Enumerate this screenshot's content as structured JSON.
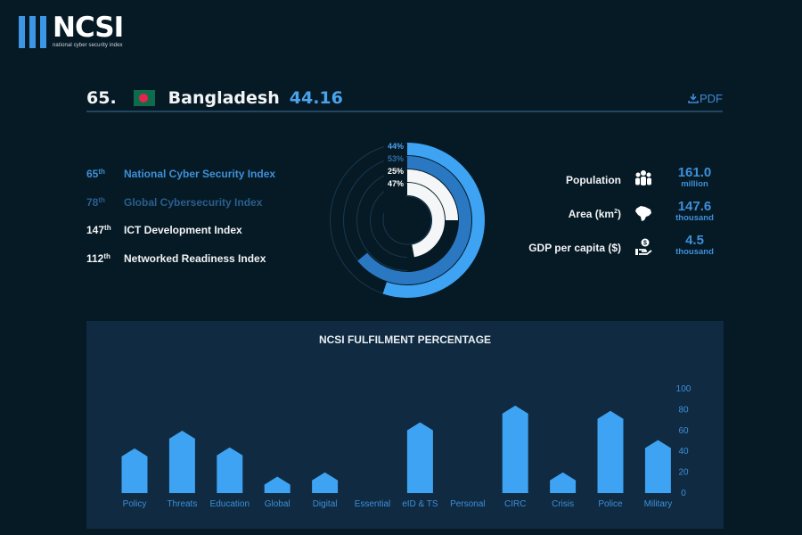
{
  "logo": {
    "word": "NCSI",
    "subtitle": "national cyber security index"
  },
  "header": {
    "rank": "65.",
    "flag_icon": "bangladesh-flag",
    "country": "Bangladesh",
    "score": "44.16",
    "pdf_label": "PDF",
    "pdf_icon": "download-icon"
  },
  "rankings": [
    {
      "rank": "65",
      "suffix": "th",
      "label": "National Cyber Security Index",
      "style": "blue"
    },
    {
      "rank": "78",
      "suffix": "th",
      "label": "Global Cybersecurity Index",
      "style": "dim"
    },
    {
      "rank": "147",
      "suffix": "th",
      "label": "ICT Development Index",
      "style": "white"
    },
    {
      "rank": "112",
      "suffix": "th",
      "label": "Networked Readiness Index",
      "style": "white"
    }
  ],
  "radial": {
    "rings": [
      {
        "label": "44%",
        "value": 44,
        "color": "#3ea3f2",
        "label_color": "#4aa2ec"
      },
      {
        "label": "53%",
        "value": 53,
        "color": "#2a78c2",
        "label_color": "#2f6ea6"
      },
      {
        "label": "25%",
        "value": 25,
        "color": "#f4f6f8",
        "label_color": "#ffffff"
      },
      {
        "label": "47%",
        "value": 47,
        "color": "#f4f6f8",
        "label_color": "#ffffff"
      }
    ]
  },
  "stats": [
    {
      "label": "Population",
      "label_sup": "",
      "icon": "people-icon",
      "value": "161.0",
      "unit": "million"
    },
    {
      "label": "Area (km",
      "label_sup": "2",
      "label_end": ")",
      "icon": "map-icon",
      "value": "147.6",
      "unit": "thousand"
    },
    {
      "label": "GDP per capita ($)",
      "label_sup": "",
      "icon": "money-hand-icon",
      "value": "4.5",
      "unit": "thousand"
    }
  ],
  "chart_data": {
    "type": "bar",
    "title": "NCSI FULFILMENT PERCENTAGE",
    "categories": [
      "Policy",
      "Threats",
      "Education",
      "Global",
      "Digital",
      "Essential",
      "eID & TS",
      "Personal",
      "CIRC",
      "Crisis",
      "Police",
      "Military"
    ],
    "values": [
      42,
      59,
      43,
      15,
      19,
      0,
      67,
      0,
      83,
      19,
      78,
      50
    ],
    "xlabel": "",
    "ylabel": "",
    "ylim": [
      0,
      100
    ],
    "yticks": [
      0,
      20,
      40,
      60,
      80,
      100
    ],
    "y_axis_side": "right",
    "bar_color": "#3ea3f2",
    "grid": false
  }
}
